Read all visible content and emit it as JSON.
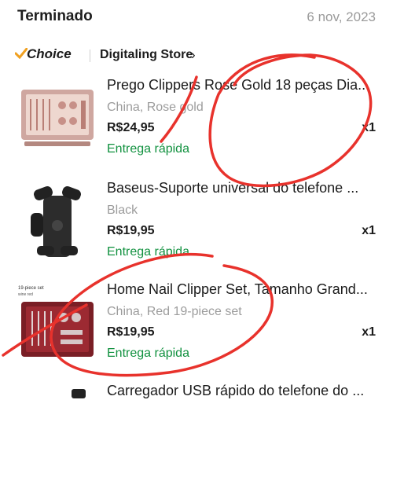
{
  "order": {
    "status": "Terminado",
    "date": "6 nov, 2023"
  },
  "store": {
    "badge": "Choice",
    "name": "Digitaling Store",
    "chevron": "›"
  },
  "items": [
    {
      "title": "Prego Clippers Rose Gold 18 peças Dia...",
      "variant": "China, Rose gold",
      "price": "R$24,95",
      "qty": "x1",
      "delivery": "Entrega rápida"
    },
    {
      "title": "Baseus-Suporte universal do telefone ...",
      "variant": "Black",
      "price": "R$19,95",
      "qty": "x1",
      "delivery": "Entrega rápida"
    },
    {
      "title": "Home Nail Clipper Set, Tamanho Grand...",
      "variant": "China, Red 19-piece set",
      "price": "R$19,95",
      "qty": "x1",
      "delivery": "Entrega rápida"
    },
    {
      "title": "Carregador USB rápido do telefone do ..."
    }
  ],
  "thumb_texts": {
    "item3_caption": "19-piece set",
    "item3_sub": "wine red"
  },
  "colors": {
    "accent": "#11913f",
    "choice_mark": "#f0a020",
    "annotation": "#e8322c",
    "muted": "#9a9a9a"
  },
  "icons": [
    "checkmark-icon",
    "chevron-right-icon"
  ]
}
